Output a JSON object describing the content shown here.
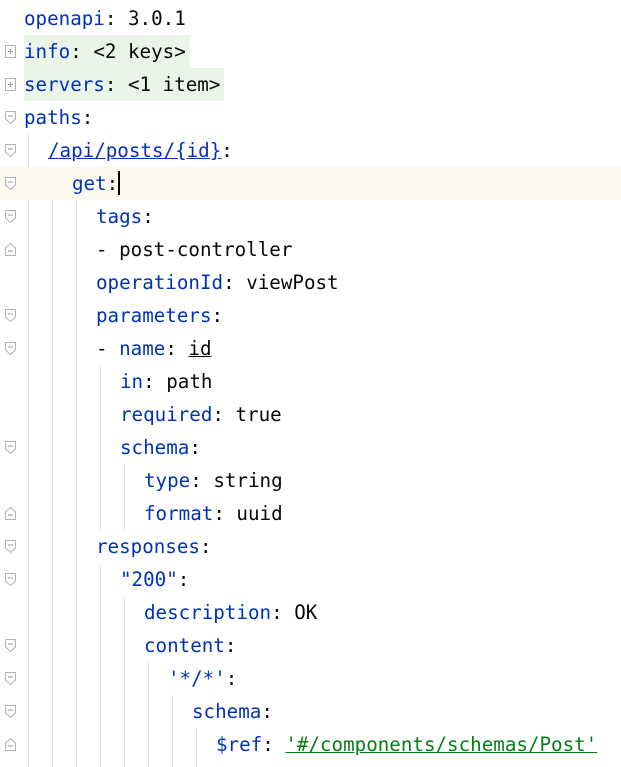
{
  "lines": [
    {
      "key": "openapi",
      "sep": ": ",
      "value": "3.0.1"
    },
    {
      "key": "info",
      "sep": ": ",
      "value": "<2 keys>"
    },
    {
      "key": "servers",
      "sep": ": ",
      "value": "<1 item>"
    },
    {
      "key": "paths",
      "sep": ":"
    },
    {
      "key": "/api/posts/{id}",
      "sep": ":"
    },
    {
      "key": "get",
      "sep": ":"
    },
    {
      "key": "tags",
      "sep": ":"
    },
    {
      "dash": "- ",
      "value": "post-controller"
    },
    {
      "key": "operationId",
      "sep": ": ",
      "value": "viewPost"
    },
    {
      "key": "parameters",
      "sep": ":"
    },
    {
      "dash": "- ",
      "key": "name",
      "sep": ": ",
      "value": "id"
    },
    {
      "key": "in",
      "sep": ": ",
      "value": "path"
    },
    {
      "key": "required",
      "sep": ": ",
      "value": "true"
    },
    {
      "key": "schema",
      "sep": ":"
    },
    {
      "key": "type",
      "sep": ": ",
      "value": "string"
    },
    {
      "key": "format",
      "sep": ": ",
      "value": "uuid"
    },
    {
      "key": "responses",
      "sep": ":"
    },
    {
      "key": "\"200\"",
      "sep": ":"
    },
    {
      "key": "description",
      "sep": ": ",
      "value": "OK"
    },
    {
      "key": "content",
      "sep": ":"
    },
    {
      "key": "'*/*'",
      "sep": ":"
    },
    {
      "key": "schema",
      "sep": ":"
    },
    {
      "key": "$ref",
      "sep": ": ",
      "value": "'#/components/schemas/Post'"
    }
  ],
  "colors": {
    "key": "#0033b3",
    "plain": "#080808",
    "string": "#067d17",
    "current_line": "#fcfaed",
    "folded_bg": "#e9f5e6"
  },
  "icons": {
    "fold_collapsed": "plus-box-icon",
    "fold_open": "fold-open-icon",
    "fold_end": "fold-end-icon"
  }
}
